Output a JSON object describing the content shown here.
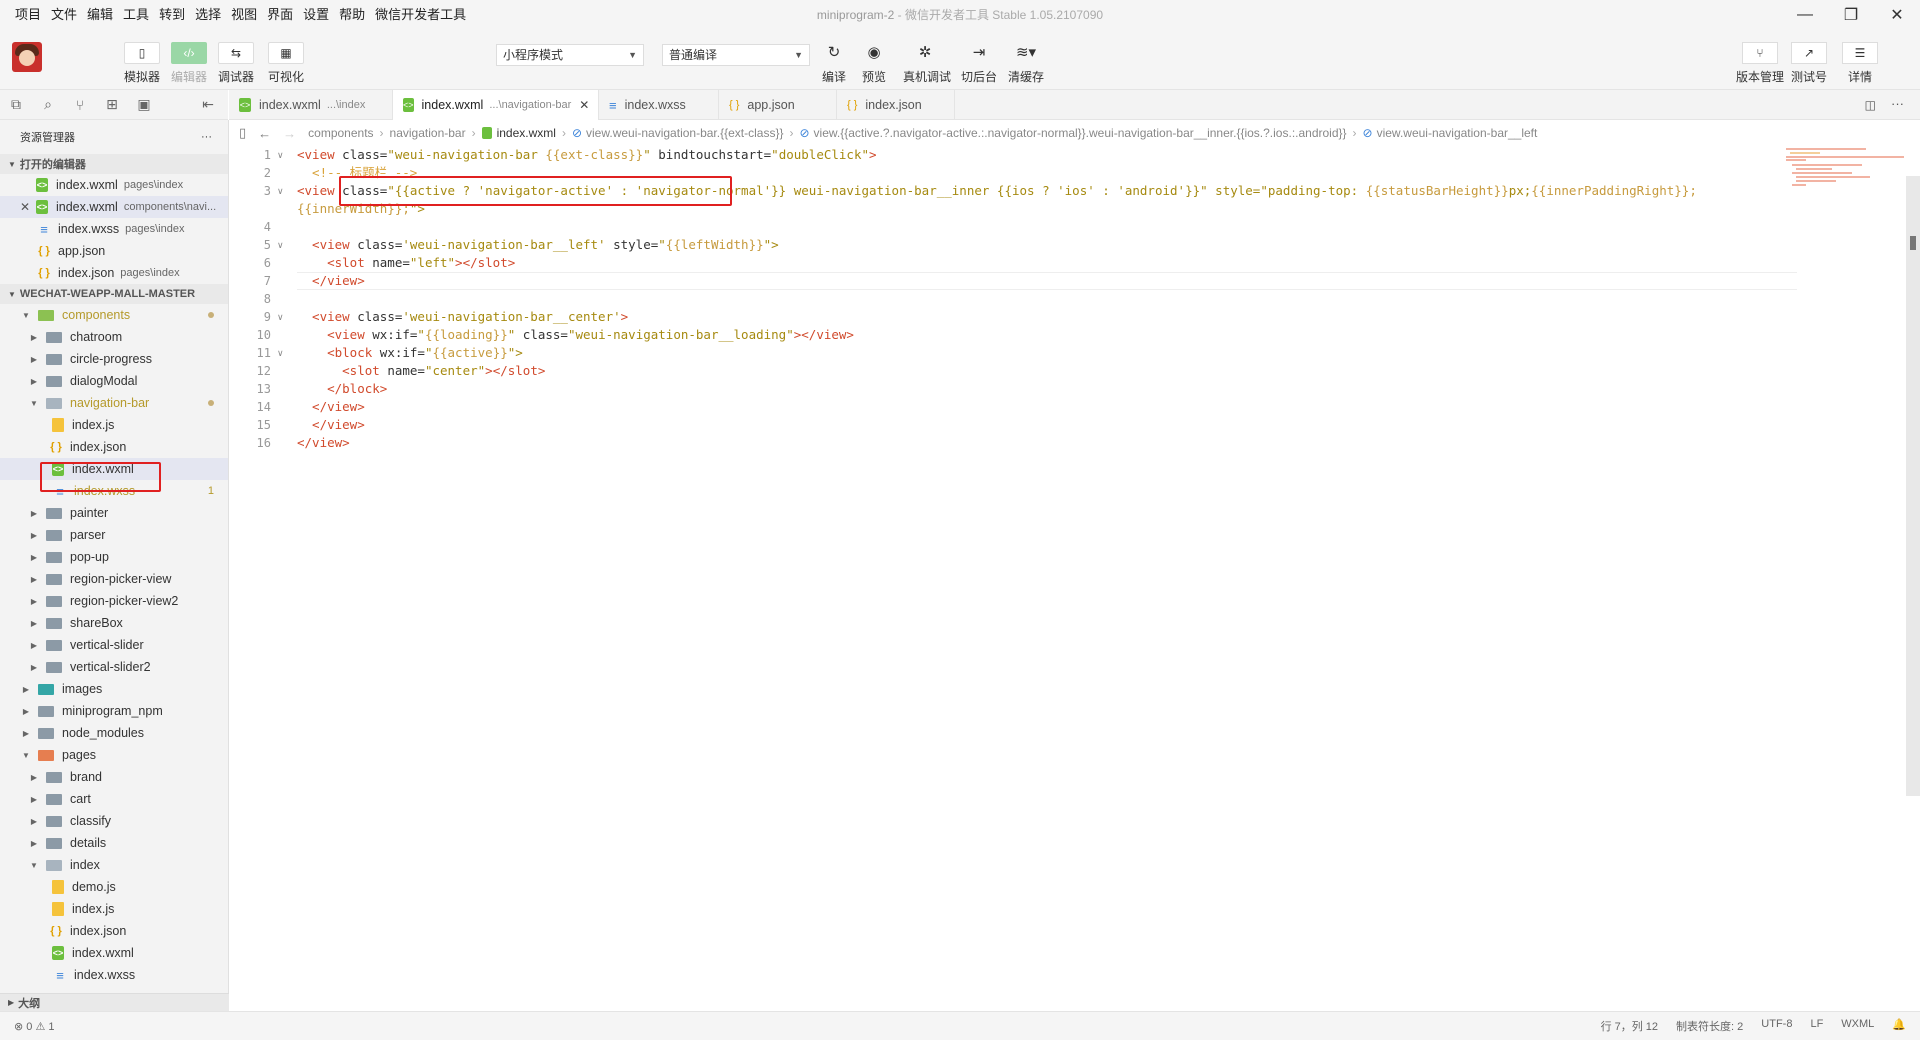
{
  "menu": [
    "项目",
    "文件",
    "编辑",
    "工具",
    "转到",
    "选择",
    "视图",
    "界面",
    "设置",
    "帮助",
    "微信开发者工具"
  ],
  "window_title": "miniprogram-2",
  "window_subtitle": "- 微信开发者工具 Stable 1.05.2107090",
  "toolbar": {
    "simulator": "模拟器",
    "editor": "编辑器",
    "debugger": "调试器",
    "visual": "可视化",
    "mode_select": "小程序模式",
    "compile_select": "普通编译",
    "compile": "编译",
    "preview": "预览",
    "remote_debug": "真机调试",
    "background": "切后台",
    "clear_cache": "清缓存",
    "version": "版本管理",
    "test": "测试号",
    "details": "详情"
  },
  "sidebar": {
    "title": "资源管理器",
    "more": "···",
    "open_editors": "打开的编辑器",
    "open_files": [
      {
        "name": "index.wxml",
        "hint": "pages\\index",
        "icon": "wxml"
      },
      {
        "name": "index.wxml",
        "hint": "components\\navi...",
        "icon": "wxml"
      },
      {
        "name": "index.wxss",
        "hint": "pages\\index",
        "icon": "wxss"
      },
      {
        "name": "app.json",
        "hint": "",
        "icon": "json"
      },
      {
        "name": "index.json",
        "hint": "pages\\index",
        "icon": "json"
      }
    ],
    "project": "WECHAT-WEAPP-MALL-MASTER",
    "tree": [
      {
        "name": "components",
        "icon": "folder-comp"
      },
      {
        "name": "chatroom"
      },
      {
        "name": "circle-progress"
      },
      {
        "name": "dialogModal"
      },
      {
        "name": "navigation-bar"
      },
      {
        "name": "index.js"
      },
      {
        "name": "index.json"
      },
      {
        "name": "index.wxml"
      },
      {
        "name": "index.wxss",
        "badge": "1"
      },
      {
        "name": "painter"
      },
      {
        "name": "parser"
      },
      {
        "name": "pop-up"
      },
      {
        "name": "region-picker-view"
      },
      {
        "name": "region-picker-view2"
      },
      {
        "name": "shareBox"
      },
      {
        "name": "vertical-slider"
      },
      {
        "name": "vertical-slider2"
      },
      {
        "name": "images"
      },
      {
        "name": "miniprogram_npm"
      },
      {
        "name": "node_modules"
      },
      {
        "name": "pages"
      },
      {
        "name": "brand"
      },
      {
        "name": "cart"
      },
      {
        "name": "classify"
      },
      {
        "name": "details"
      },
      {
        "name": "index"
      },
      {
        "name": "demo.js"
      },
      {
        "name": "index.js"
      },
      {
        "name": "index.json"
      },
      {
        "name": "index.wxml"
      },
      {
        "name": "index.wxss"
      }
    ],
    "outline": "大纲"
  },
  "tabs": [
    {
      "name": "index.wxml",
      "path": "...\\index"
    },
    {
      "name": "index.wxml",
      "path": "...\\navigation-bar"
    },
    {
      "name": "index.wxss",
      "path": ""
    },
    {
      "name": "app.json",
      "path": ""
    },
    {
      "name": "index.json",
      "path": ""
    }
  ],
  "breadcrumb": {
    "components": "components",
    "navigation_bar": "navigation-bar",
    "file": "index.wxml",
    "b1": "view.weui-navigation-bar.{{ext-class}}",
    "b2": "view.{{active.?.navigator-active.:.navigator-normal}}.weui-navigation-bar__inner.{{ios.?.ios.:.android}}",
    "b3": "view.weui-navigation-bar__left"
  },
  "code": {
    "line_numbers": [
      "1",
      "2",
      "3",
      "4",
      "5",
      "6",
      "7",
      "8",
      "9",
      "10",
      "11",
      "12",
      "13",
      "14",
      "15",
      "16"
    ],
    "l1a": "<view",
    "l1b": " class=",
    "l1c": "\"weui-navigation-bar ",
    "l1d": "{{ext-class}}",
    "l1e": "\"",
    "l1f": " bindtouchstart=",
    "l1g": "\"doubleClick\"",
    "l1h": ">",
    "l2": "  <!-- 标题栏 -->",
    "l3a": "<view",
    "l3b": " class=",
    "l3c": "\"",
    "l3d": "{{active ? 'navigator-active' : 'navigator-normal'}}",
    "l3e": " weui-navigation-bar__inner ",
    "l3f": "{{ios ? 'ios' : 'android'}}",
    "l3g": "\" style=",
    "l3h": "\"padding-top: ",
    "l3i": "{{statusBarHeight}}",
    "l3j": "px;",
    "l3k": "{{innerPaddingRight}};",
    "l3l": "{{innerWidth}};",
    "l3m": "\">",
    "l5a": "  <view",
    "l5b": " class=",
    "l5c": "'weui-navigation-bar__left'",
    "l5d": " style=",
    "l5e": "\"",
    "l5f": "{{leftWidth}}",
    "l5g": "\">",
    "l6a": "    <slot",
    "l6b": " name=",
    "l6c": "\"left\"",
    "l6d": "></slot>",
    "l7": "  </view>",
    "l9a": "  <view",
    "l9b": " class=",
    "l9c": "'weui-navigation-bar__center'",
    "l9d": ">",
    "l10a": "    <view",
    "l10b": " wx:if=",
    "l10c": "\"",
    "l10d": "{{loading}}",
    "l10e": "\"",
    "l10f": " class=",
    "l10g": "\"weui-navigation-bar__loading\"",
    "l10h": "></view>",
    "l11a": "    <block",
    "l11b": " wx:if=",
    "l11c": "\"",
    "l11d": "{{active}}",
    "l11e": "\">",
    "l12a": "      <slot",
    "l12b": " name=",
    "l12c": "\"center\"",
    "l12d": "></slot>",
    "l13": "    </block>",
    "l14": "  </view>",
    "l15": "  </view>",
    "l16": "</view>"
  },
  "status": {
    "errors": "⊗ 0 ⚠ 1",
    "position": "行 7，列 12",
    "tab_size": "制表符长度: 2",
    "encoding": "UTF-8",
    "eol": "LF",
    "language": "WXML"
  }
}
